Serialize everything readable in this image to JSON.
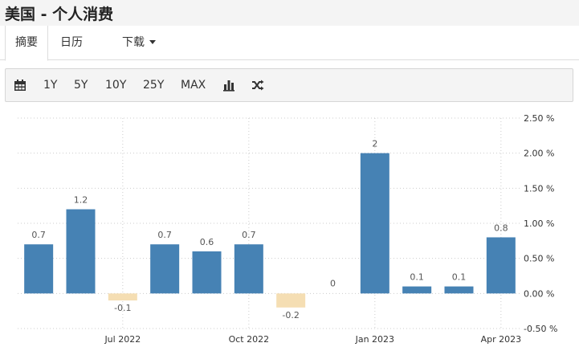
{
  "header": {
    "title": "美国 - 个人消费"
  },
  "tabs": [
    {
      "label": "摘要",
      "active": true
    },
    {
      "label": "日历",
      "active": false
    },
    {
      "label": "下载",
      "active": false
    }
  ],
  "toolbar": {
    "calendar_icon": "calendar-icon",
    "ranges": [
      "1Y",
      "5Y",
      "10Y",
      "25Y",
      "MAX"
    ],
    "bar_chart_icon": "bar-chart-icon",
    "shuffle_icon": "shuffle-icon"
  },
  "colors": {
    "positive": "#4682b4",
    "negative": "#f5deb3",
    "grid": "#cccccc"
  },
  "chart_data": {
    "type": "bar",
    "categories": [
      "2022-05",
      "2022-06",
      "2022-07",
      "2022-08",
      "2022-09",
      "2022-10",
      "2022-11",
      "2022-12",
      "2023-01",
      "2023-02",
      "2023-03",
      "2023-04"
    ],
    "values": [
      0.7,
      1.2,
      -0.1,
      0.7,
      0.6,
      0.7,
      -0.2,
      0,
      2,
      0.1,
      0.1,
      0.8
    ],
    "value_labels": [
      "0.7",
      "1.2",
      "-0.1",
      "0.7",
      "0.6",
      "0.7",
      "-0.2",
      "0",
      "2",
      "0.1",
      "0.1",
      "0.8"
    ],
    "x_ticks": [
      "Jul 2022",
      "Oct 2022",
      "Jan 2023",
      "Apr 2023"
    ],
    "y_ticks": [
      "2.50 %",
      "2.00 %",
      "1.50 %",
      "1.00 %",
      "0.50 %",
      "0.00 %",
      "-0.50 %"
    ],
    "y_tick_values": [
      2.5,
      2.0,
      1.5,
      1.0,
      0.5,
      0.0,
      -0.5
    ],
    "ylim": [
      -0.5,
      2.5
    ],
    "y_axis_position": "right",
    "grid": true
  }
}
